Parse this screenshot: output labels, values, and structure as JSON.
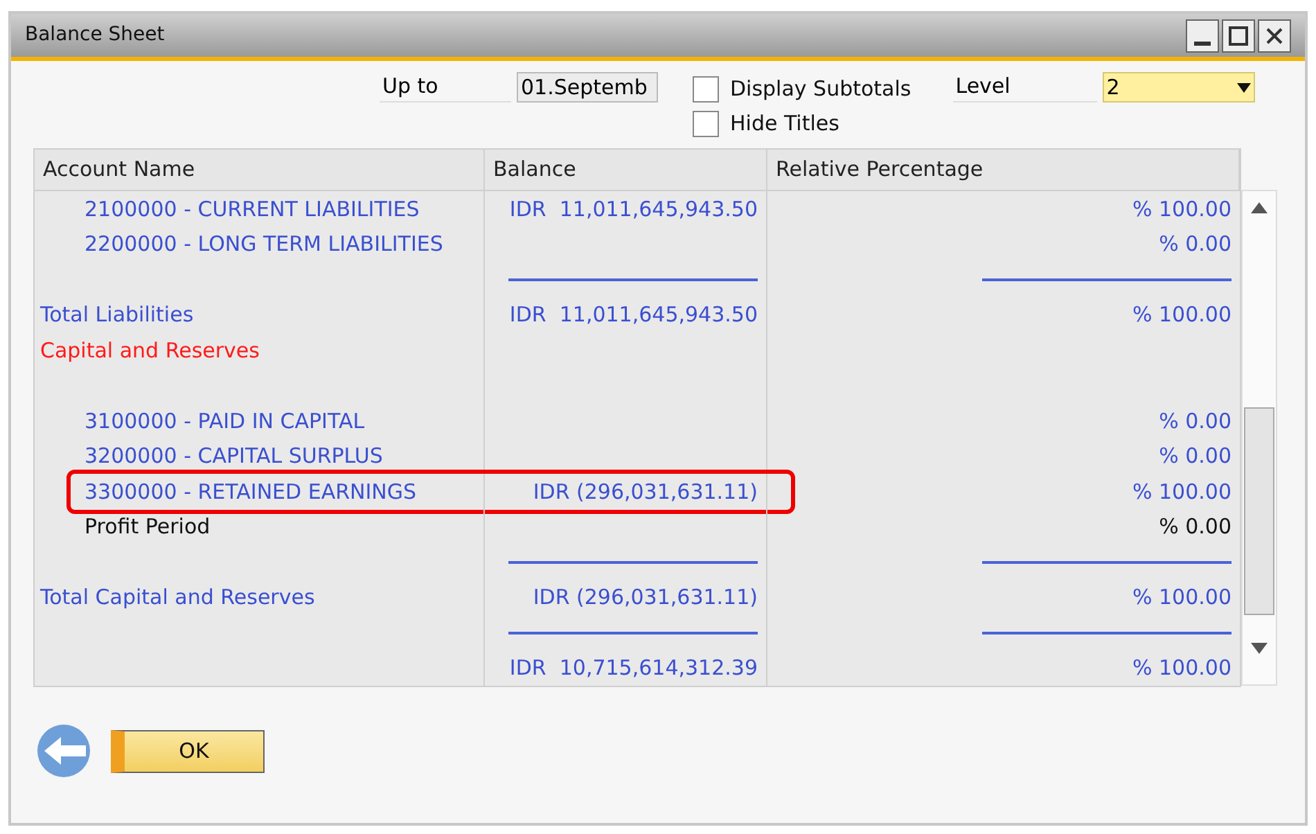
{
  "window": {
    "title": "Balance Sheet"
  },
  "filters": {
    "up_to_label": "Up to",
    "up_to_value": "01.Septemb",
    "options": [
      {
        "label": "Display Subtotals",
        "checked": false
      },
      {
        "label": "Hide Titles",
        "checked": false
      }
    ],
    "level_label": "Level",
    "level_value": "2"
  },
  "table": {
    "columns": [
      "Account Name",
      "Balance",
      "Relative Percentage"
    ],
    "rows": [
      {
        "kind": "item",
        "name": "2100000 - CURRENT LIABILITIES",
        "balance": "IDR  11,011,645,943.50",
        "percentage": "% 100.00",
        "highlighted": false
      },
      {
        "kind": "item",
        "name": "2200000 - LONG TERM LIABILITIES",
        "balance": "",
        "percentage": "% 0.00",
        "highlighted": false
      },
      {
        "kind": "rule"
      },
      {
        "kind": "total",
        "name": "Total Liabilities",
        "balance": "IDR  11,011,645,943.50",
        "percentage": "% 100.00",
        "highlighted": false
      },
      {
        "kind": "heading",
        "name": "Capital and Reserves",
        "balance": "",
        "percentage": "",
        "highlighted": false
      },
      {
        "kind": "blank"
      },
      {
        "kind": "item",
        "name": "3100000 - PAID IN CAPITAL",
        "balance": "",
        "percentage": "% 0.00",
        "highlighted": false
      },
      {
        "kind": "item",
        "name": "3200000 - CAPITAL SURPLUS",
        "balance": "",
        "percentage": "% 0.00",
        "highlighted": false
      },
      {
        "kind": "item",
        "name": "3300000 - RETAINED EARNINGS",
        "balance": "IDR (296,031,631.11)",
        "percentage": "% 100.00",
        "highlighted": true
      },
      {
        "kind": "plain",
        "name": "Profit Period",
        "balance": "",
        "percentage": "% 0.00",
        "highlighted": false
      },
      {
        "kind": "rule"
      },
      {
        "kind": "total",
        "name": "Total Capital and Reserves",
        "balance": "IDR (296,031,631.11)",
        "percentage": "% 100.00",
        "highlighted": false
      },
      {
        "kind": "rule"
      },
      {
        "kind": "total",
        "name": "",
        "balance": "IDR  10,715,614,312.39",
        "percentage": "% 100.00",
        "highlighted": false
      }
    ]
  },
  "buttons": {
    "ok": "OK"
  }
}
